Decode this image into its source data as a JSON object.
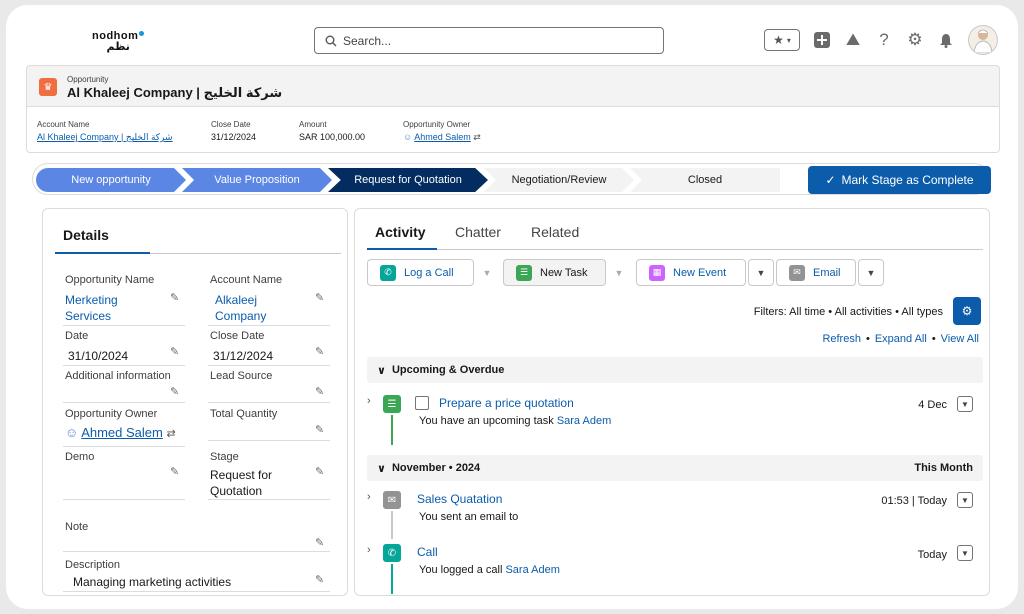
{
  "brand": {
    "logo_en": "nodhom",
    "logo_ar": "نظم"
  },
  "search": {
    "placeholder": "Search..."
  },
  "record": {
    "type": "Opportunity",
    "title": "Al Khaleej Company | شركة الخليج"
  },
  "highlights": [
    {
      "label": "Account Name",
      "value": "Al Khaleej Company | شركة الخليج",
      "link": true
    },
    {
      "label": "Close Date",
      "value": "31/12/2024",
      "link": false
    },
    {
      "label": "Amount",
      "value": "SAR 100,000.00",
      "link": false
    },
    {
      "label": "Opportunity Owner",
      "value": "Ahmed Salem",
      "link": true
    }
  ],
  "path": {
    "stages": [
      "New opportunity",
      "Value Proposition",
      "Request for Quotation",
      "Negotiation/Review",
      "Closed"
    ],
    "mark_complete": "Mark Stage as Complete"
  },
  "details": {
    "tab": "Details",
    "fields": {
      "opportunity_name": {
        "label": "Opportunity Name",
        "value": "Merketing Services"
      },
      "account_name": {
        "label": "Account Name",
        "value": "Alkaleej Company"
      },
      "date": {
        "label": "Date",
        "value": "31/10/2024"
      },
      "close_date": {
        "label": "Close Date",
        "value": "31/12/2024"
      },
      "additional_info": {
        "label": "Additional information",
        "value": ""
      },
      "lead_source": {
        "label": "Lead Source",
        "value": ""
      },
      "owner": {
        "label": "Opportunity Owner",
        "value": "Ahmed Salem"
      },
      "total_quantity": {
        "label": "Total Quantity",
        "value": ""
      },
      "demo": {
        "label": "Demo",
        "value": ""
      },
      "stage": {
        "label": "Stage",
        "value": "Request for Quotation"
      },
      "note": {
        "label": "Note",
        "value": ""
      },
      "description": {
        "label": "Description",
        "value": "Managing marketing activities"
      }
    }
  },
  "activity": {
    "tabs": [
      "Activity",
      "Chatter",
      "Related"
    ],
    "buttons": {
      "log_call": "Log a Call",
      "new_task": "New Task",
      "new_event": "New Event",
      "email": "Email"
    },
    "filters": "Filters: All time • All activities • All types",
    "refresh": "Refresh",
    "expand_all": "Expand All",
    "view_all": "View All",
    "sep": "•",
    "upcoming_header": "Upcoming & Overdue",
    "task": {
      "title": "Prepare a price quotation",
      "desc": "You have an upcoming task",
      "who": "Sara Adem",
      "date": "4 Dec"
    },
    "month_header": "November • 2024",
    "month_right": "This Month",
    "email_item": {
      "title": "Sales Quatation",
      "desc": "You sent an email to",
      "time": "01:53 | Today"
    },
    "call_item": {
      "title": "Call",
      "desc": "You logged a call",
      "who": "Sara Adem",
      "time": "Today"
    }
  },
  "colors": {
    "brand_blue": "#0b5cab",
    "path_done": "#5b86e3",
    "path_current": "#032d60",
    "call": "#06a59a",
    "task": "#3ba755",
    "event": "#cb65ff",
    "email": "#939393"
  }
}
